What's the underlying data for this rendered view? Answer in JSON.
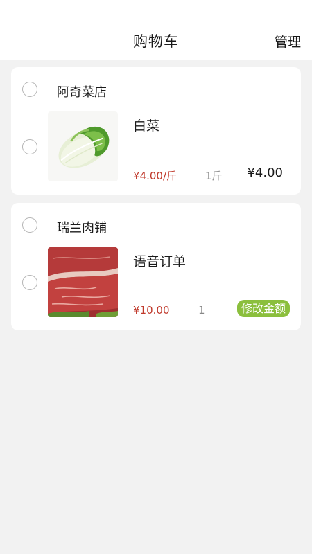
{
  "header": {
    "title": "购物车",
    "manage_label": "管理"
  },
  "cart": [
    {
      "shop_name": "阿奇菜店",
      "item": {
        "name": "白菜",
        "image_icon": "napa-cabbage-image",
        "price": "¥4.00/斤",
        "quantity": "1斤",
        "subtotal": "¥4.00"
      }
    },
    {
      "shop_name": "瑞兰肉铺",
      "item": {
        "name": "语音订单",
        "image_icon": "raw-beef-image",
        "price": "¥10.00",
        "quantity": "1",
        "action_label": "修改金额"
      }
    }
  ],
  "colors": {
    "price": "#c0392b",
    "accent_green": "#8bbf3d",
    "background": "#f2f2f2"
  }
}
